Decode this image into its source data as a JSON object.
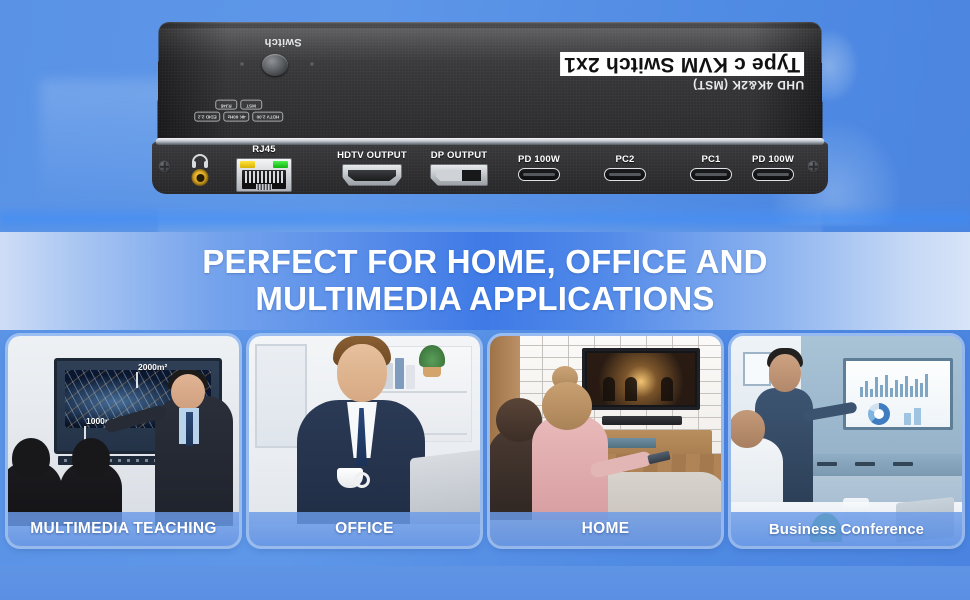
{
  "device": {
    "brand_main": "Type c KVM Switch 2x1",
    "brand_sub": "UHD 4K&2K  (MST)",
    "switch_label": "Switch",
    "badges": [
      [
        "HDTV 2.00",
        "4K 60Hz",
        "EDID 2.2"
      ],
      [
        "MST",
        "RJ45"
      ]
    ],
    "ports": [
      {
        "name": "audio-jack",
        "label": ""
      },
      {
        "name": "rj45",
        "label": "RJ45"
      },
      {
        "name": "hdmi",
        "label": "HDTV OUTPUT"
      },
      {
        "name": "displayport",
        "label": "DP OUTPUT"
      },
      {
        "name": "usbc-pd-left",
        "label": "PD 100W"
      },
      {
        "name": "usbc-pc2",
        "label": "PC2"
      },
      {
        "name": "usbc-pc1",
        "label": "PC1"
      },
      {
        "name": "usbc-pd-right",
        "label": "PD 100W"
      }
    ]
  },
  "banner": {
    "line1": "PERFECT FOR HOME, OFFICE AND",
    "line2": "MULTIMEDIA APPLICATIONS"
  },
  "cards": [
    {
      "caption": "MULTIMEDIA TEACHING",
      "annotations": {
        "upper": "2000m²",
        "lower": "1000m²"
      }
    },
    {
      "caption": "OFFICE"
    },
    {
      "caption": "HOME"
    },
    {
      "caption": "Business Conference"
    }
  ],
  "colors": {
    "background_blue": "#5a93e6",
    "banner_blue": "#3f7ae6",
    "caption_blue": "#6c9ce8",
    "device_dark": "#343437",
    "jack_gold": "#d9a521",
    "led_yellow": "#ffe23a",
    "led_green": "#4cf04c",
    "text_white": "#ffffff"
  }
}
